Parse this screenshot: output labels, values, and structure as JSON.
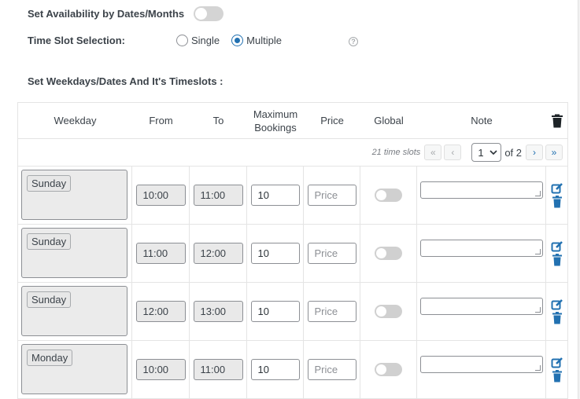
{
  "settings": {
    "availability_label": "Set Availability by Dates/Months",
    "availability_enabled": false,
    "slot_selection_label": "Time Slot Selection:",
    "slot_options": [
      {
        "label": "Single",
        "checked": false
      },
      {
        "label": "Multiple",
        "checked": true
      }
    ],
    "help_icon": "question-circle-icon",
    "weekdays_label": "Set Weekdays/Dates And It's Timeslots :"
  },
  "table": {
    "columns": {
      "weekday": "Weekday",
      "from": "From",
      "to": "To",
      "max_bookings": "Maximum Bookings",
      "price": "Price",
      "global": "Global",
      "note": "Note"
    },
    "header_icon": "trash-icon",
    "pager": {
      "count": "21 time slots",
      "first": "«",
      "prev": "‹",
      "page": "1",
      "of": "of 2",
      "next": "›",
      "last": "»"
    },
    "price_placeholder": "Price",
    "rows": [
      {
        "weekday": "Sunday",
        "from": "10:00",
        "to": "11:00",
        "max": "10",
        "global": false,
        "note": ""
      },
      {
        "weekday": "Sunday",
        "from": "11:00",
        "to": "12:00",
        "max": "10",
        "global": false,
        "note": ""
      },
      {
        "weekday": "Sunday",
        "from": "12:00",
        "to": "13:00",
        "max": "10",
        "global": false,
        "note": ""
      },
      {
        "weekday": "Monday",
        "from": "10:00",
        "to": "11:00",
        "max": "10",
        "global": false,
        "note": ""
      }
    ]
  },
  "colors": {
    "accent": "#2271b1",
    "text": "#3c434a",
    "header_trash": "#1d2327"
  }
}
